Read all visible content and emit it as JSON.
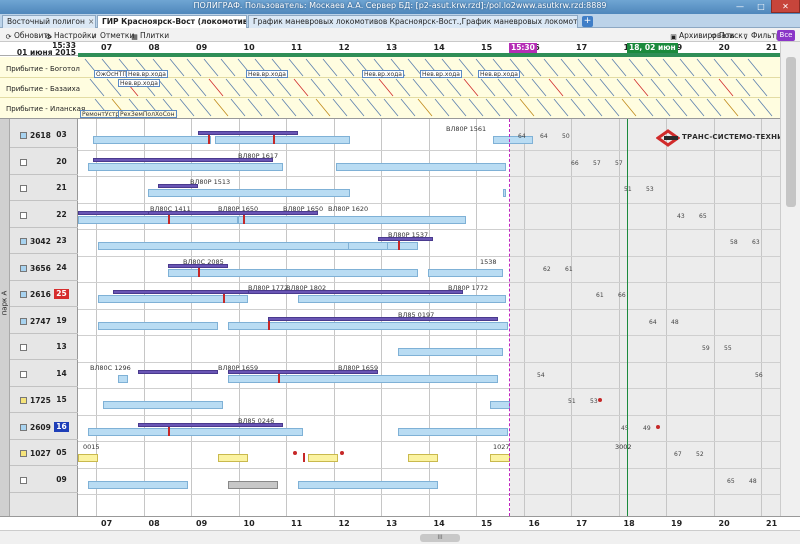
{
  "window": {
    "title": "ПОЛИГРАФ. Пользователь: Москаев А.А. Сервер БД: [p2-asut.krw.rzd]:/pol.lo2www.asutkrw.rzd:8889",
    "min_label": "—",
    "max_label": "□",
    "close_label": "✕"
  },
  "tabs": [
    {
      "label": "Восточный полигон",
      "close": "×"
    },
    {
      "label": "ГИР Красноярск-Вост (локомотивы АСУСТ)",
      "close": "×"
    },
    {
      "label": "График маневровых локомотивов Красноярск-Вост.,График маневровых локомотивов Красноярск-Вост",
      "close": "×"
    },
    {
      "label": "+"
    }
  ],
  "toolbar": {
    "refresh": "Обновить",
    "settings": "Настройки",
    "marks": "Отметки",
    "tiles": "Плитки",
    "archive": "Архивировать",
    "search": "Поиск",
    "filter": "Фильтр",
    "all": "Все"
  },
  "header": {
    "time": "15:33",
    "date": "01 июня 2015",
    "ticks": [
      "07",
      "08",
      "09",
      "10",
      "11",
      "12",
      "13",
      "14",
      "15",
      "16",
      "17",
      "18",
      "19",
      "20",
      "21"
    ],
    "now_badge": "15:30",
    "date_badge": "18, 02 июн"
  },
  "arrivals": [
    {
      "label": "Прибытие - Боготол"
    },
    {
      "label": "Прибытие - Базаиха"
    },
    {
      "label": "Прибытие - Иланская"
    }
  ],
  "arrival_tags": [
    "ОжОсНТП",
    "Нев.вр.хода",
    "Нев.вр.хода",
    "Нев.вр.хода",
    "Нев.вр.хода",
    "Нев.вр.хода",
    "Нев.вр.хода",
    "РемонтУстр",
    "РехЗемПолХоСон"
  ],
  "group_label": "парк А",
  "locos": [
    {
      "loco": "2618",
      "num": "03",
      "sq": "#a8d3f0",
      "badge": "",
      "nc": "#000"
    },
    {
      "loco": "",
      "num": "20",
      "sq": "#ffffff",
      "badge": "",
      "nc": "#000"
    },
    {
      "loco": "",
      "num": "21",
      "sq": "#ffffff",
      "badge": "",
      "nc": "#000"
    },
    {
      "loco": "",
      "num": "22",
      "sq": "#ffffff",
      "badge": "",
      "nc": "#000"
    },
    {
      "loco": "3042",
      "num": "23",
      "sq": "#a8d3f0",
      "badge": "",
      "nc": "#000"
    },
    {
      "loco": "3656",
      "num": "24",
      "sq": "#a8d3f0",
      "badge": "",
      "nc": "#000"
    },
    {
      "loco": "2616",
      "num": "25",
      "sq": "#a8d3f0",
      "badge": "#d62d2d",
      "nc": "#fff"
    },
    {
      "loco": "2747",
      "num": "19",
      "sq": "#a8d3f0",
      "badge": "",
      "nc": "#000"
    },
    {
      "loco": "",
      "num": "13",
      "sq": "#ffffff",
      "badge": "",
      "nc": "#000"
    },
    {
      "loco": "",
      "num": "14",
      "sq": "#ffffff",
      "badge": "",
      "nc": "#000"
    },
    {
      "loco": "1725",
      "num": "15",
      "sq": "#f5e37a",
      "badge": "",
      "nc": "#000"
    },
    {
      "loco": "2609",
      "num": "16",
      "sq": "#a8d3f0",
      "badge": "#1f3fb8",
      "nc": "#fff"
    },
    {
      "loco": "1027",
      "num": "05",
      "sq": "#f5e37a",
      "badge": "",
      "nc": "#000"
    },
    {
      "loco": "",
      "num": "09",
      "sq": "#ffffff",
      "badge": "",
      "nc": "#000"
    }
  ],
  "bar_labels": [
    "ВЛ80Р 1561",
    "ВЛ80Р 1617",
    "ВЛ80Р 1513",
    "ВЛ80С 1411",
    "ВЛ80Р 1650",
    "ВЛ80Р 1620",
    "ВЛ80Р 1650",
    "ВЛ80Р 1537",
    "ВЛ80С 2085",
    "1538",
    "ВЛ80Р 1772",
    "ВЛ80Р 1802",
    "ВЛ80Р 1772",
    "ВЛ85 0197",
    "ВЛ80С 1296",
    "ВЛ80Р 1659",
    "ВЛ80Р 1659",
    "ВЛ85 0246",
    "0015",
    "1027",
    "3002"
  ],
  "trail_labels": [
    "64",
    "66",
    "51",
    "43",
    "58",
    "62",
    "61",
    "64",
    "59",
    "56",
    "51",
    "45",
    "67",
    "65",
    "64",
    "57",
    "53",
    "65",
    "63",
    "61",
    "66",
    "48",
    "55",
    "54",
    "53",
    "49",
    "52",
    "48",
    "50",
    "57"
  ],
  "logo": {
    "text": "ТРАНС-СИСТЕМО-ТЕХНИКА"
  },
  "colors": {
    "now_line": "#c023c0",
    "current_time_badge": "#b52db5",
    "date_badge": "#1b8a3d",
    "accent": "#8b35c8"
  },
  "scrollbar": {
    "h_thumb": "III"
  }
}
